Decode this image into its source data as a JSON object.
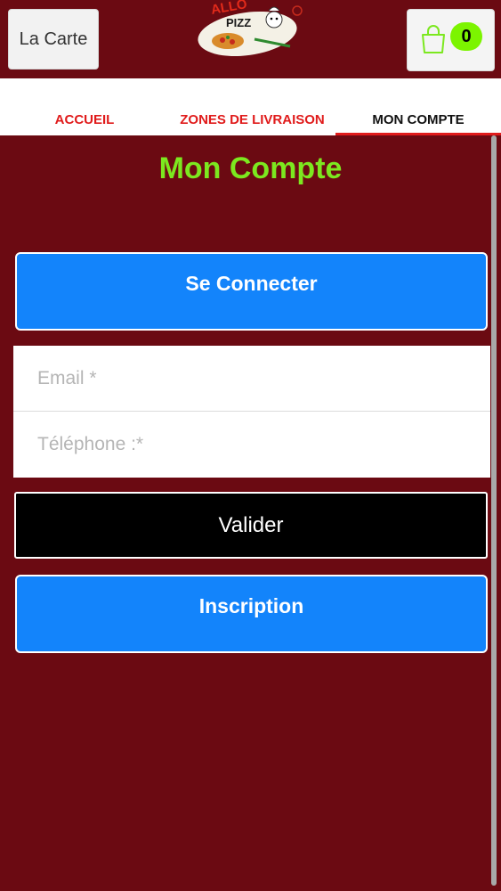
{
  "header": {
    "menu_label": "La Carte",
    "logo_text": "ALLO PIZZA",
    "cart_count": "0"
  },
  "tabs": [
    {
      "label": "ACCUEIL"
    },
    {
      "label": "ZONES DE LIVRAISON"
    },
    {
      "label": "MON COMPTE"
    }
  ],
  "page": {
    "title": "Mon Compte",
    "login_label": "Se Connecter",
    "email_placeholder": "Email *",
    "phone_placeholder": "Téléphone :*",
    "submit_label": "Valider",
    "register_label": "Inscription"
  },
  "colors": {
    "background": "#6b0a12",
    "accent_green": "#7ce81f",
    "button_blue": "#1384fb",
    "tab_red": "#e01b1b"
  }
}
